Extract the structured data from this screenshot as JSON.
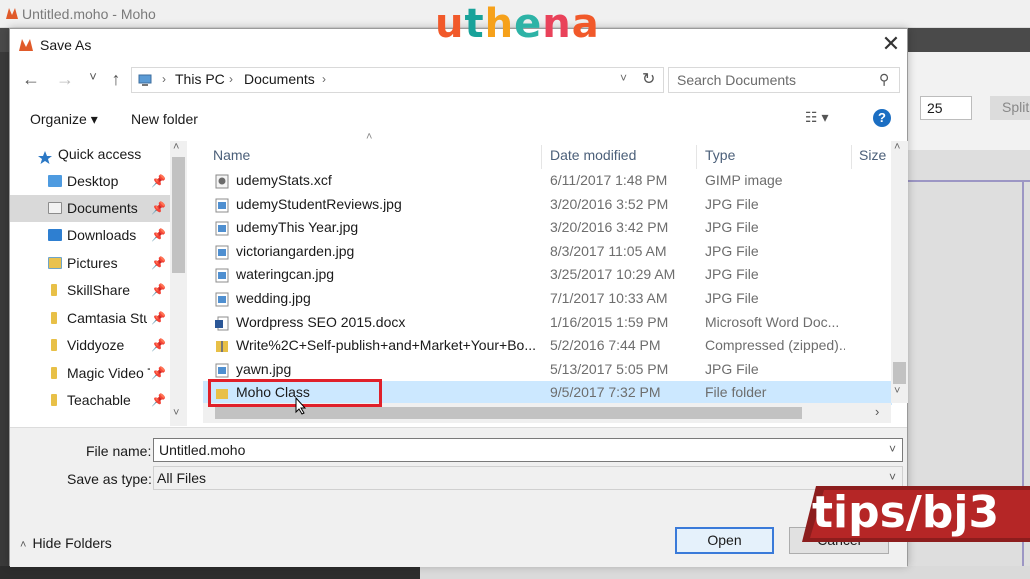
{
  "background_app": {
    "title": "Untitled.moho - Moho",
    "field_value": "25",
    "split_label": "Split"
  },
  "logo": {
    "letters": [
      "u",
      "t",
      "h",
      "e",
      "n",
      "a"
    ],
    "colors": [
      "#f1592a",
      "#19a29a",
      "#f6a11a",
      "#2db3a6",
      "#e9425a",
      "#f1592a"
    ]
  },
  "dialog": {
    "title": "Save As",
    "close_glyph": "✕",
    "nav": {
      "back": "←",
      "forward": "→",
      "recent": "˅",
      "up": "↑"
    },
    "breadcrumb": [
      "This PC",
      "Documents"
    ],
    "search_placeholder": "Search Documents",
    "organize_label": "Organize ▾",
    "new_folder_label": "New folder",
    "help_glyph": "?",
    "view_glyph": "☷ ▾"
  },
  "nav_pane": [
    {
      "label": "Quick access",
      "icon": "star-icon",
      "pinned": false,
      "quick": true
    },
    {
      "label": "Desktop",
      "icon": "desktop-folder-icon",
      "pinned": true
    },
    {
      "label": "Documents",
      "icon": "documents-folder-icon",
      "pinned": true,
      "selected": true
    },
    {
      "label": "Downloads",
      "icon": "downloads-folder-icon",
      "pinned": true
    },
    {
      "label": "Pictures",
      "icon": "pictures-folder-icon",
      "pinned": true
    },
    {
      "label": "SkillShare",
      "icon": "folder-icon",
      "pinned": true
    },
    {
      "label": "Camtasia Stuc",
      "icon": "folder-icon",
      "pinned": true
    },
    {
      "label": "Viddyoze",
      "icon": "folder-icon",
      "pinned": true
    },
    {
      "label": "Magic Video T",
      "icon": "folder-icon",
      "pinned": true
    },
    {
      "label": "Teachable",
      "icon": "folder-icon",
      "pinned": true
    }
  ],
  "columns": [
    "Name",
    "Date modified",
    "Type",
    "Size"
  ],
  "files": [
    {
      "name": "udemyStats.xcf",
      "date": "6/11/2017 1:48 PM",
      "type": "GIMP image",
      "icon": "gimp-file-icon"
    },
    {
      "name": "udemyStudentReviews.jpg",
      "date": "3/20/2016 3:52 PM",
      "type": "JPG File",
      "icon": "image-file-icon"
    },
    {
      "name": "udemyThis Year.jpg",
      "date": "3/20/2016 3:42 PM",
      "type": "JPG File",
      "icon": "image-file-icon"
    },
    {
      "name": "victoriangarden.jpg",
      "date": "8/3/2017 11:05 AM",
      "type": "JPG File",
      "icon": "image-file-icon"
    },
    {
      "name": "wateringcan.jpg",
      "date": "3/25/2017 10:29 AM",
      "type": "JPG File",
      "icon": "image-file-icon"
    },
    {
      "name": "wedding.jpg",
      "date": "7/1/2017 10:33 AM",
      "type": "JPG File",
      "icon": "image-file-icon"
    },
    {
      "name": "Wordpress SEO 2015.docx",
      "date": "1/16/2015 1:59 PM",
      "type": "Microsoft Word Doc...",
      "icon": "word-file-icon"
    },
    {
      "name": "Write%2C+Self-publish+and+Market+Your+Bo...",
      "date": "5/2/2016 7:44 PM",
      "type": "Compressed (zipped)...",
      "icon": "zip-file-icon"
    },
    {
      "name": "yawn.jpg",
      "date": "5/13/2017 5:05 PM",
      "type": "JPG File",
      "icon": "image-file-icon"
    },
    {
      "name": "Moho Class",
      "date": "9/5/2017 7:32 PM",
      "type": "File folder",
      "icon": "folder-icon",
      "selected": true
    }
  ],
  "form": {
    "file_name_label": "File name:",
    "file_name_value": "Untitled.moho",
    "save_type_label": "Save as type:",
    "save_type_value": "All Files",
    "open_label": "Open",
    "cancel_label": "Cancel",
    "hide_folders_label": "Hide Folders"
  },
  "watermark": "tips/bj3"
}
